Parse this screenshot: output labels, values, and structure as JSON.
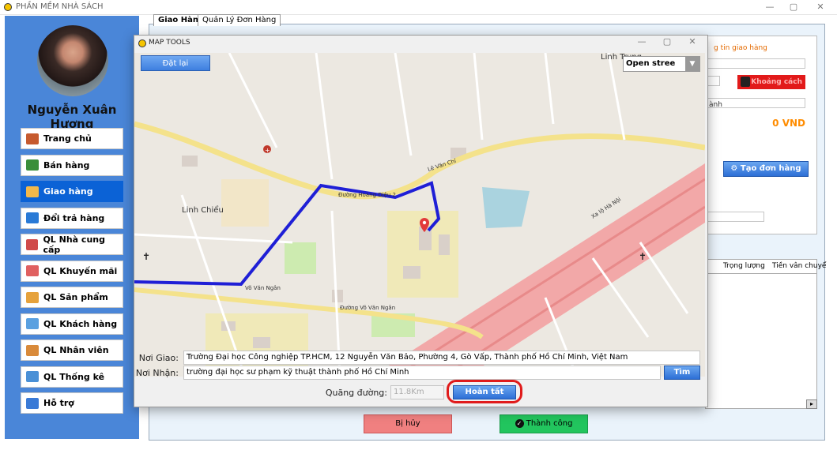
{
  "app": {
    "title": "PHẦN MỀM NHÀ SÁCH",
    "window_controls": [
      "—",
      "▢",
      "✕"
    ]
  },
  "user": {
    "name": "Nguyễn Xuân Hương"
  },
  "sidebar": {
    "items": [
      {
        "label": "Trang chủ",
        "icon": "home-icon"
      },
      {
        "label": "Bán hàng",
        "icon": "cart-icon"
      },
      {
        "label": "Giao hàng",
        "icon": "truck-icon",
        "active": true
      },
      {
        "label": "Đổi trả hàng",
        "icon": "refresh-icon"
      },
      {
        "label": "QL Nhà cung cấp",
        "icon": "factory-icon"
      },
      {
        "label": "QL Khuyến mãi",
        "icon": "sale-icon"
      },
      {
        "label": "QL Sản phẩm",
        "icon": "product-icon"
      },
      {
        "label": "QL Khách hàng",
        "icon": "customer-icon"
      },
      {
        "label": "QL Nhân viên",
        "icon": "employee-icon"
      },
      {
        "label": "QL Thống kê",
        "icon": "chart-icon"
      },
      {
        "label": "Hỗ trợ",
        "icon": "help-icon"
      }
    ]
  },
  "tabs": [
    {
      "label": "Giao Hàng"
    },
    {
      "label": "Quản Lý Đơn Hàng"
    }
  ],
  "right_panel": {
    "section_title": "g tin giao hàng",
    "distance_button": "Khoảng cách",
    "partial_text": "ành",
    "price": "0 VND",
    "create_order_button": "Tạo đơn hàng",
    "columns": [
      "Trọng lượng",
      "Tiền vân chuyể"
    ]
  },
  "bottom_actions": {
    "cancel": "Bị hủy",
    "success": "Thành công"
  },
  "map_tools": {
    "title": "MAP TOOLS",
    "reset_button": "Đặt lại",
    "tile_source": "Open stree",
    "labels": {
      "from": "Nơi Giao:",
      "to": "Nơi Nhận:",
      "distance": "Quãng đường:"
    },
    "from_value": "Trường Đại học Công nghiệp TP.HCM, 12 Nguyễn Văn Bảo, Phường 4, Gò Vấp, Thành phố Hồ Chí Minh, Việt Nam",
    "to_value": "trường đại học sư phạm kỹ thuật thành phố Hồ Chí Minh",
    "distance_value": "11.8Km",
    "search_button": "Tìm",
    "finish_button": "Hoàn tất",
    "map_labels": [
      "Linh Chiểu",
      "Linh Trung",
      "Võ Văn Ngân",
      "Lê Văn Chí",
      "Xa lộ Hà Nội",
      "Đường Võ Văn Ngân",
      "Đường Hoàng Diệu 2"
    ]
  }
}
